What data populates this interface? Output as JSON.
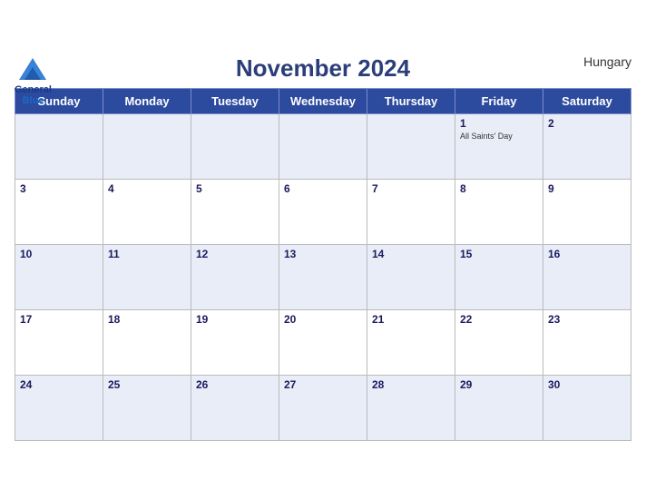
{
  "header": {
    "title": "November 2024",
    "brand_general": "General",
    "brand_blue": "Blue",
    "country": "Hungary"
  },
  "days_of_week": [
    "Sunday",
    "Monday",
    "Tuesday",
    "Wednesday",
    "Thursday",
    "Friday",
    "Saturday"
  ],
  "weeks": [
    [
      {
        "day": "",
        "holiday": ""
      },
      {
        "day": "",
        "holiday": ""
      },
      {
        "day": "",
        "holiday": ""
      },
      {
        "day": "",
        "holiday": ""
      },
      {
        "day": "",
        "holiday": ""
      },
      {
        "day": "1",
        "holiday": "All Saints' Day"
      },
      {
        "day": "2",
        "holiday": ""
      }
    ],
    [
      {
        "day": "3",
        "holiday": ""
      },
      {
        "day": "4",
        "holiday": ""
      },
      {
        "day": "5",
        "holiday": ""
      },
      {
        "day": "6",
        "holiday": ""
      },
      {
        "day": "7",
        "holiday": ""
      },
      {
        "day": "8",
        "holiday": ""
      },
      {
        "day": "9",
        "holiday": ""
      }
    ],
    [
      {
        "day": "10",
        "holiday": ""
      },
      {
        "day": "11",
        "holiday": ""
      },
      {
        "day": "12",
        "holiday": ""
      },
      {
        "day": "13",
        "holiday": ""
      },
      {
        "day": "14",
        "holiday": ""
      },
      {
        "day": "15",
        "holiday": ""
      },
      {
        "day": "16",
        "holiday": ""
      }
    ],
    [
      {
        "day": "17",
        "holiday": ""
      },
      {
        "day": "18",
        "holiday": ""
      },
      {
        "day": "19",
        "holiday": ""
      },
      {
        "day": "20",
        "holiday": ""
      },
      {
        "day": "21",
        "holiday": ""
      },
      {
        "day": "22",
        "holiday": ""
      },
      {
        "day": "23",
        "holiday": ""
      }
    ],
    [
      {
        "day": "24",
        "holiday": ""
      },
      {
        "day": "25",
        "holiday": ""
      },
      {
        "day": "26",
        "holiday": ""
      },
      {
        "day": "27",
        "holiday": ""
      },
      {
        "day": "28",
        "holiday": ""
      },
      {
        "day": "29",
        "holiday": ""
      },
      {
        "day": "30",
        "holiday": ""
      }
    ]
  ],
  "colors": {
    "header_bg": "#2c4a9e",
    "odd_row_bg": "#e8edf8",
    "even_row_bg": "#ffffff",
    "day_number_color": "#1a1a5e"
  }
}
